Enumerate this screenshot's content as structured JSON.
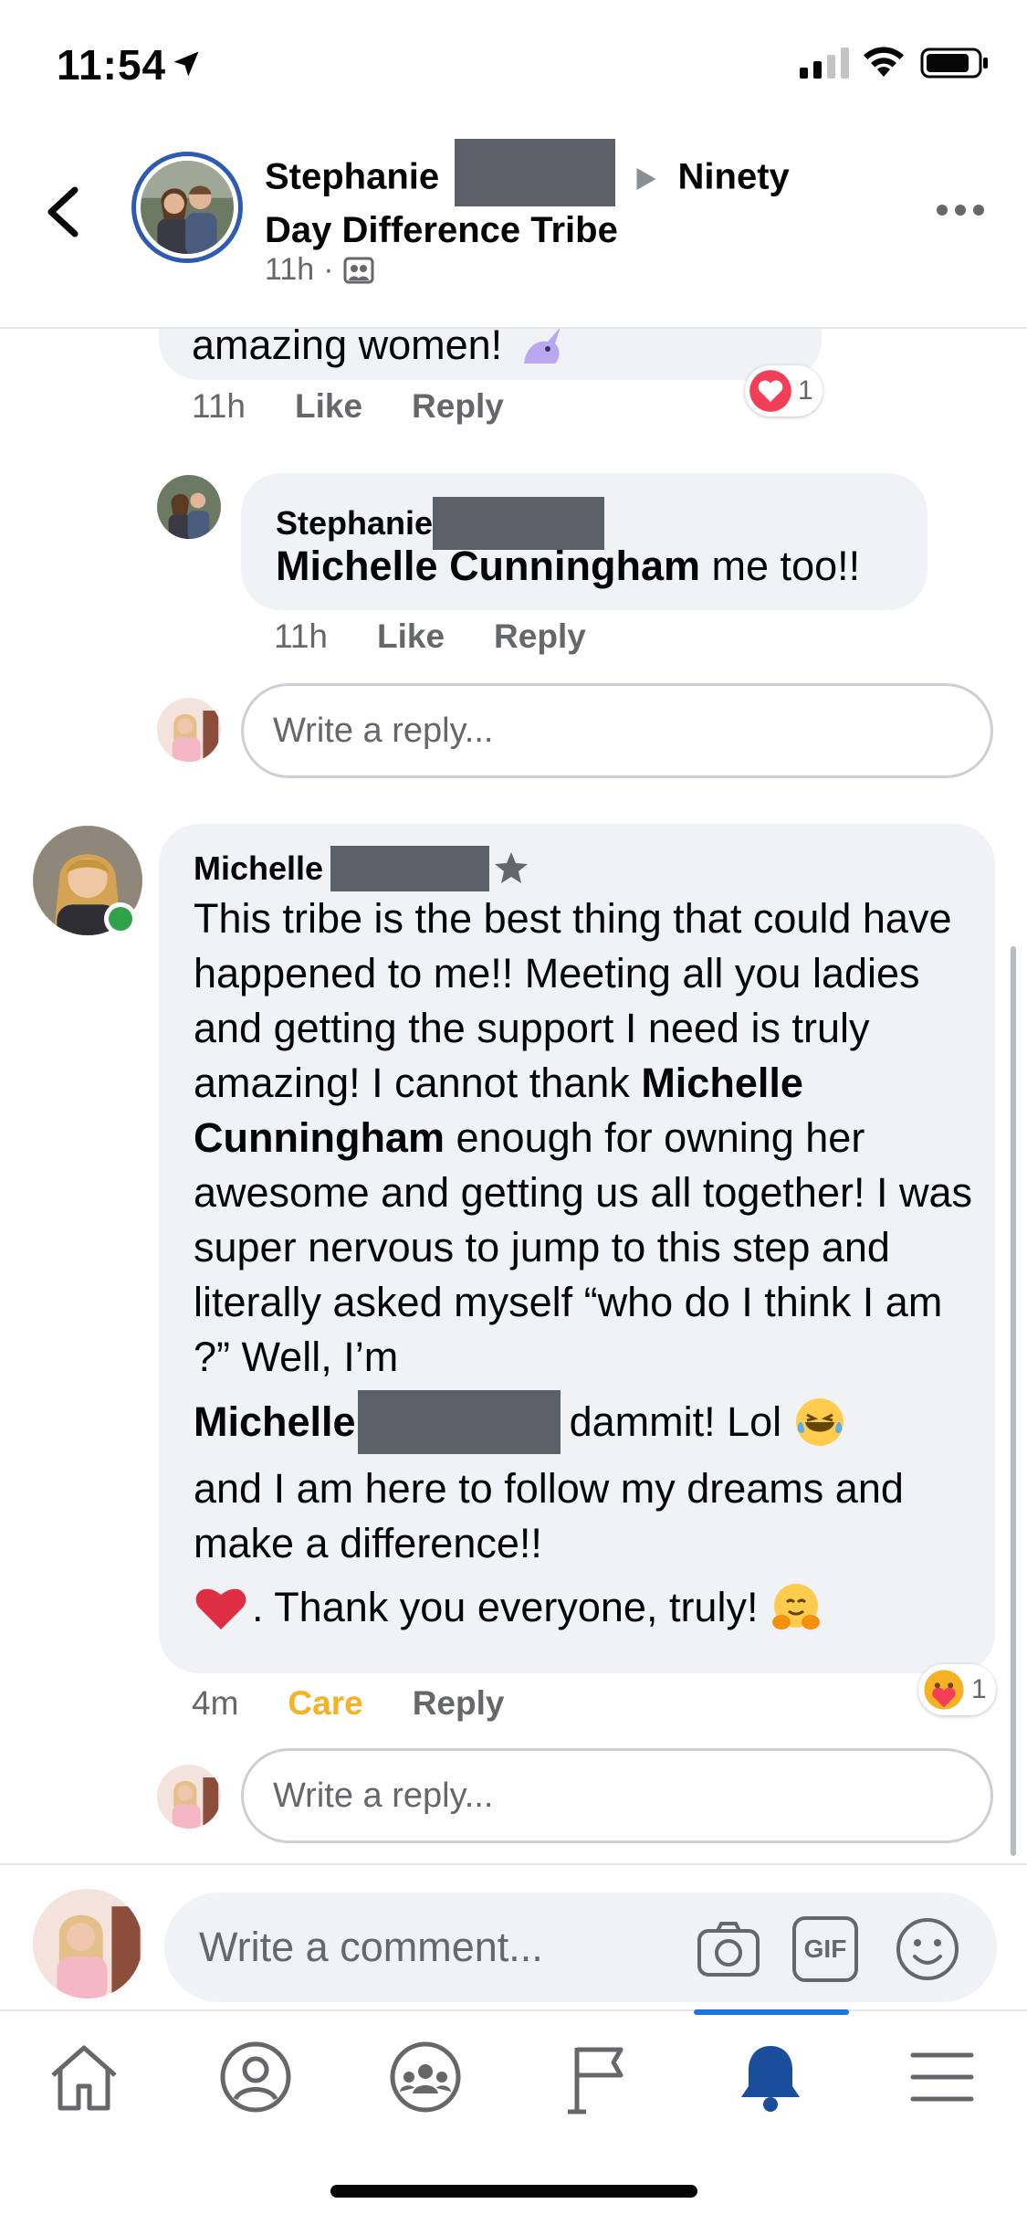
{
  "status_bar": {
    "time": "11:54"
  },
  "header": {
    "name_part1": "Stephanie",
    "group_part1": "Ninety",
    "group_part2": "Day Difference Tribe",
    "time_ago": "11h",
    "separator": "·"
  },
  "top_comment": {
    "text_fragment": "amazing women!",
    "time": "11h",
    "like_label": "Like",
    "reply_label": "Reply",
    "reaction_count": "1"
  },
  "reply_1": {
    "author": "Stephanie",
    "mention": "Michelle Cunningham",
    "text": "me too!!",
    "time": "11h",
    "like_label": "Like",
    "reply_label": "Reply"
  },
  "reply_box_1": {
    "placeholder": "Write a reply..."
  },
  "main_comment": {
    "author": "Michelle",
    "text_a": "This tribe is the best thing that could have happened to me!! Meeting all you ladies and getting the support I need is truly amazing! I cannot thank",
    "mention": "Michelle Cunningham",
    "text_b": "enough for owning her awesome and getting us all together! I was super nervous to jump to this step and literally asked myself “who do I think I am ?” Well, I’m",
    "self_name": "Michelle",
    "text_c": "dammit! Lol",
    "text_d": "and I am here to follow my dreams and make a difference!!",
    "text_e": ". Thank you everyone, truly!",
    "time": "4m",
    "care_label": "Care",
    "reply_label": "Reply",
    "reaction_count": "1"
  },
  "reply_box_2": {
    "placeholder": "Write a reply..."
  },
  "composer": {
    "placeholder": "Write a comment...",
    "gif_label": "GIF"
  },
  "colors": {
    "care": "#f7b125",
    "accent": "#1b74e4",
    "bubble": "#f0f2f5",
    "secondary_text": "#65676b",
    "online": "#31a24c"
  },
  "icons": [
    "location-arrow-icon",
    "signal-icon",
    "wifi-icon",
    "battery-icon",
    "back-chevron-icon",
    "more-icon",
    "group-icon",
    "camera-icon",
    "gif-icon",
    "emoji-icon",
    "home-icon",
    "profile-icon",
    "groups-icon",
    "pages-flag-icon",
    "notifications-bell-icon",
    "menu-icon"
  ]
}
